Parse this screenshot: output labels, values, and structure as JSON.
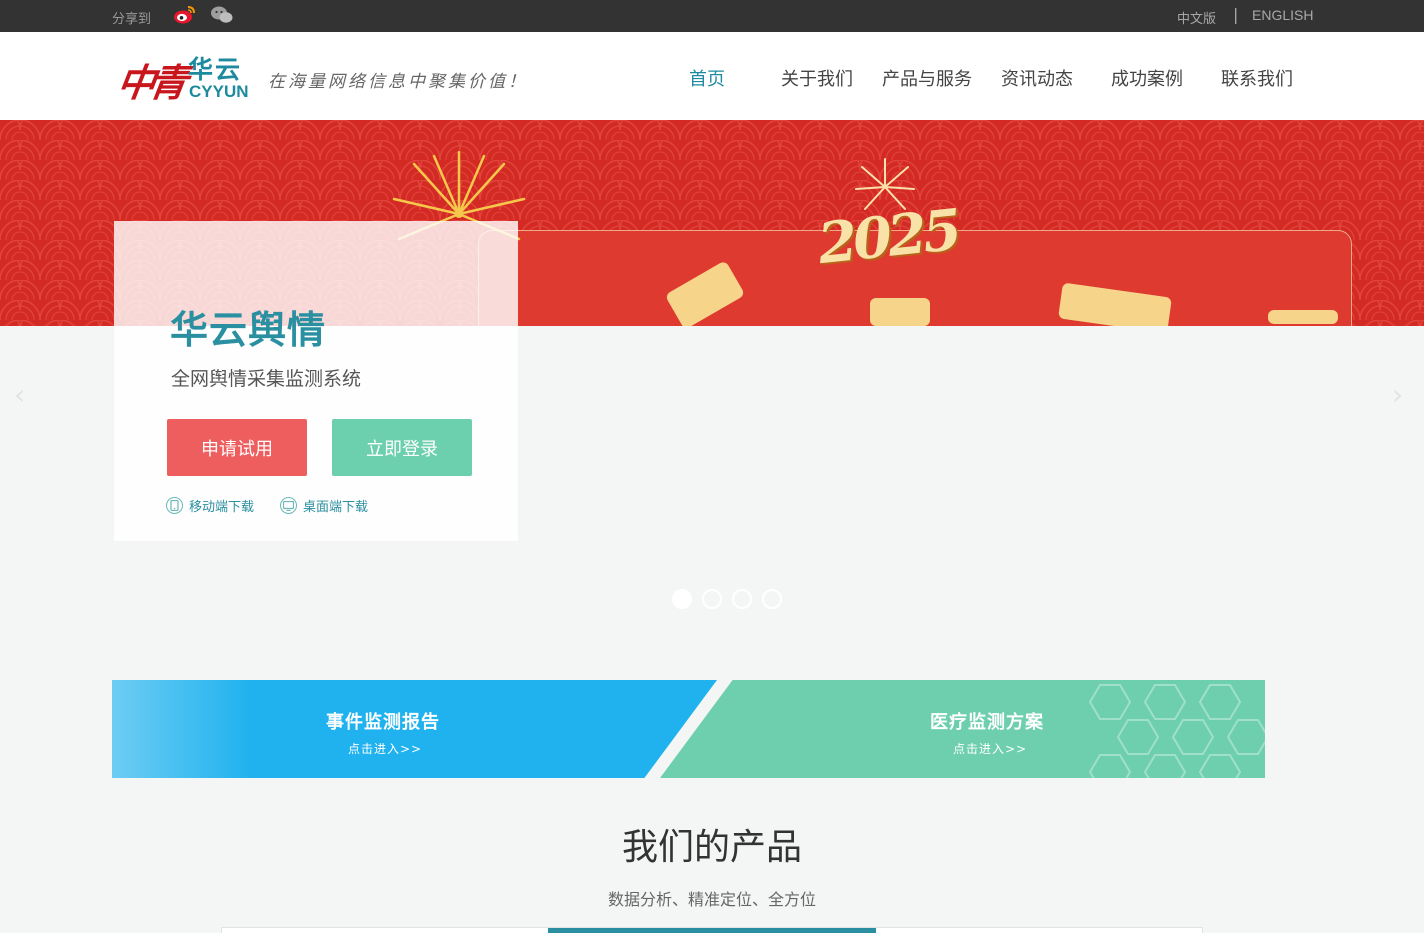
{
  "topbar": {
    "share_label": "分享到",
    "share_icons": [
      "weibo-icon",
      "wechat-icon"
    ],
    "lang_cn": "中文版",
    "lang_sep": "|",
    "lang_en": "ENGLISH"
  },
  "header": {
    "logo_mark": "中青",
    "logo_cn": "华云",
    "logo_en": "CYYUN",
    "slogan": "在海量网络信息中聚集价值！",
    "nav": [
      "首页",
      "关于我们",
      "产品与服务",
      "资讯动态",
      "成功案例",
      "联系我们"
    ],
    "nav_active": "首页"
  },
  "banner": {
    "year_text": "2025",
    "card_title": "华云舆情",
    "card_subtitle": "全网舆情采集监测系统",
    "btn_trial": "申请试用",
    "btn_login": "立即登录",
    "download_mobile": "移动端下载",
    "download_desktop": "桌面端下载",
    "slide_count": 4,
    "active_slide": 1
  },
  "promo": {
    "left_title": "事件监测报告",
    "left_link": "点击进入>>",
    "right_title": "医疗监测方案",
    "right_link": "点击进入>>"
  },
  "products": {
    "title": "我们的产品",
    "subtitle": "数据分析、精准定位、全方位"
  },
  "colors": {
    "brand_teal": "#1d8aa0",
    "brand_red": "#c8161d",
    "trial_red": "#ee5e5e",
    "login_green": "#6ccfae",
    "promo_blue": "#1fb2ee",
    "promo_green": "#6dcfae",
    "banner_red": "#d42a24"
  }
}
